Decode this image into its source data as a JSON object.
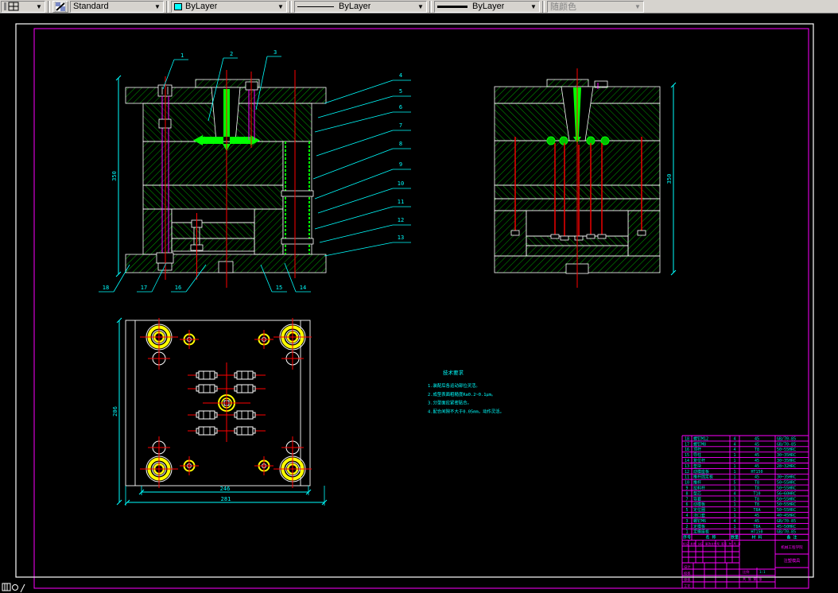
{
  "app": {
    "name": "AutoCAD drawing window"
  },
  "toolbar": {
    "text_style_value": "Standard",
    "color_value": "ByLayer",
    "linetype_value": "ByLayer",
    "lineweight_value": "ByLayer",
    "plot_style_value": "随颜色",
    "color_swatch": "#00FFFF"
  },
  "drawing": {
    "colors": {
      "hatch_green": "#00B400",
      "bright_green": "#00FF00",
      "dimension_cyan": "#00FFFF",
      "centerline_red": "#FF0000",
      "frame_magenta": "#FF00FF",
      "bushing_yellow": "#FFFF00",
      "outline_white": "#FFFFFF"
    },
    "leaders": {
      "top": [
        "1",
        "2",
        "3"
      ],
      "right": [
        "4",
        "5",
        "6",
        "7",
        "8",
        "9",
        "10",
        "11",
        "12",
        "13"
      ],
      "bottom": [
        "18",
        "17",
        "16",
        "15",
        "14"
      ]
    },
    "dims": {
      "left_section": "350",
      "right_section": "350",
      "plan_left": "206",
      "plan_inner": "246",
      "plan_outer": "281"
    },
    "notes": {
      "title": "技术要求",
      "items": [
        "1.装配后各运动部位灵活。",
        "2.成型表面粗糙度Ra0.2~0.1μm。",
        "3.分型面应紧密贴合。",
        "4.配合间隙不大于0.05mm，动作灵活。"
      ]
    }
  },
  "bom": {
    "headers": [
      "序号",
      "名  称",
      "数量",
      "材  料",
      "备  注"
    ],
    "rows": [
      [
        "18",
        "螺钉M12",
        "4",
        "45",
        "GB/70-85"
      ],
      [
        "17",
        "螺钉M8",
        "4",
        "45",
        "GB/70-85"
      ],
      [
        "16",
        "顶杆",
        "4",
        "T8",
        "50~55HRC"
      ],
      [
        "15",
        "导柱",
        "1",
        "45",
        "30~35HRC"
      ],
      [
        "14",
        "复位杆",
        "1",
        "45",
        "30~35HRC"
      ],
      [
        "13",
        "垫块",
        "1",
        "45",
        "28~32HRC"
      ],
      [
        "12",
        "动模座板",
        "1",
        "HT150",
        ""
      ],
      [
        "11",
        "推杆固定板",
        "1",
        "45",
        "30~35HRC"
      ],
      [
        "10",
        "推杆",
        "5",
        "T8",
        "50~55HRC"
      ],
      [
        "9",
        "拉料杆",
        "1",
        "T8",
        "50~55HRC"
      ],
      [
        "8",
        "型芯",
        "4",
        "T10",
        "56~60HRC"
      ],
      [
        "7",
        "导套",
        "1",
        "T8",
        "50~55HRC"
      ],
      [
        "6",
        "动模板",
        "1",
        "T8",
        "50~55HRC"
      ],
      [
        "5",
        "定位圈",
        "1",
        "T8A",
        "50~55HRC"
      ],
      [
        "4",
        "浇口套",
        "1",
        "45",
        "40~45HRC"
      ],
      [
        "3",
        "螺钉M6",
        "4",
        "45",
        "GB/70-85"
      ],
      [
        "2",
        "定模板",
        "1",
        "T8A",
        "45~50HRC"
      ],
      [
        "1",
        "定模座板",
        "1",
        "HT150",
        "GB/70-85"
      ]
    ]
  },
  "title_block": {
    "school": "机械工程学院",
    "drawing_title": "注塑模具",
    "revision_row": "标记 处数 分区 更改文件号 签名 年.月.日",
    "designers": [
      "设计",
      "校核",
      "审核",
      "工艺"
    ],
    "scale_label": "比例",
    "scale_value": "1:1",
    "sheet_label": "共 张 第 张"
  }
}
